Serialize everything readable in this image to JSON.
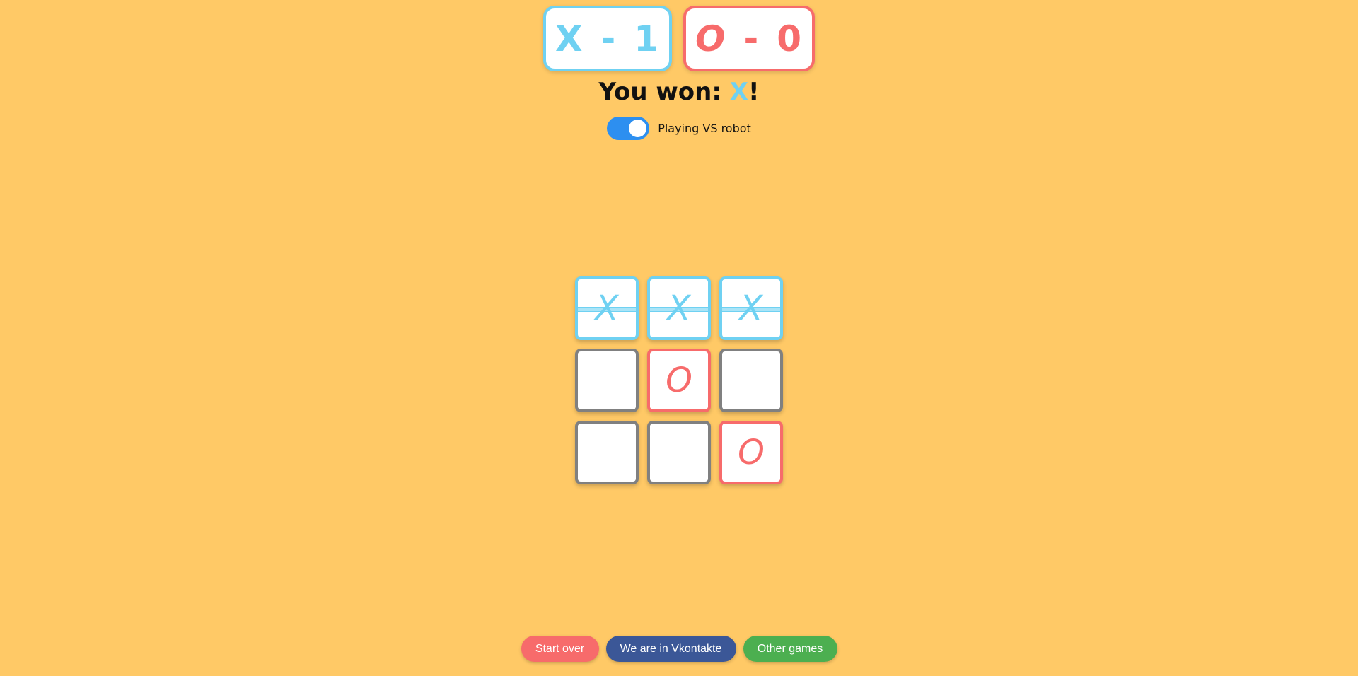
{
  "scoreboard": {
    "x": {
      "symbol": "X",
      "separator": "-",
      "score": "1",
      "color": "#6fd1f2"
    },
    "o": {
      "symbol": "O",
      "separator": "-",
      "score": "0",
      "color": "#f76b6b"
    }
  },
  "status": {
    "prefix": "You won: ",
    "winner": "X",
    "suffix": "!"
  },
  "toggle": {
    "label": "Playing VS robot",
    "on": true,
    "color": "#2d8ff0"
  },
  "board": {
    "cells": [
      {
        "mark": "X",
        "winning": true
      },
      {
        "mark": "X",
        "winning": true
      },
      {
        "mark": "X",
        "winning": true
      },
      {
        "mark": "",
        "winning": false
      },
      {
        "mark": "O",
        "winning": false
      },
      {
        "mark": "",
        "winning": false
      },
      {
        "mark": "",
        "winning": false
      },
      {
        "mark": "",
        "winning": false
      },
      {
        "mark": "O",
        "winning": false
      }
    ]
  },
  "footer": {
    "restart_label": "Start over",
    "vk_label": "We are in Vkontakte",
    "games_label": "Other games"
  },
  "colors": {
    "background": "#ffc966",
    "x_color": "#6fd1f2",
    "o_color": "#f76b6b",
    "empty_border": "#808080",
    "restart": "#f76b6b",
    "vk": "#3b5797",
    "games": "#4caf50"
  }
}
